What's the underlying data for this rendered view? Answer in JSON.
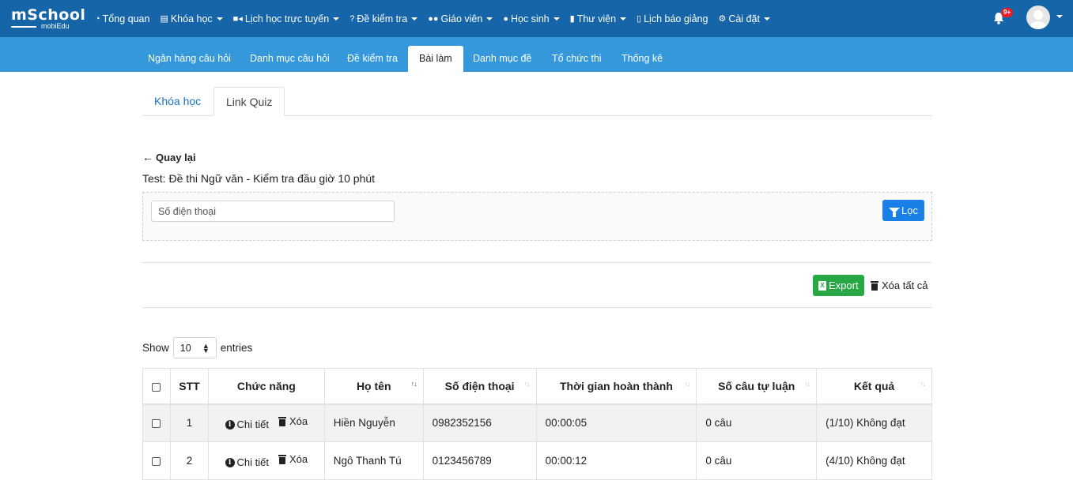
{
  "logo": {
    "main": "mSchool",
    "sub": "mobiEdu"
  },
  "nav": [
    {
      "label": "Tổng quan",
      "icon": "dashboard-icon",
      "caret": false
    },
    {
      "label": "Khóa học",
      "icon": "list-icon",
      "caret": true
    },
    {
      "label": "Lịch học trực tuyến",
      "icon": "video-icon",
      "caret": true
    },
    {
      "label": "Đề kiểm tra",
      "icon": "question-icon",
      "caret": true
    },
    {
      "label": "Giáo viên",
      "icon": "users-icon",
      "caret": true
    },
    {
      "label": "Học sinh",
      "icon": "user-icon",
      "caret": true
    },
    {
      "label": "Thư viện",
      "icon": "book-icon",
      "caret": true
    },
    {
      "label": "Lịch báo giảng",
      "icon": "clipboard-icon",
      "caret": false
    },
    {
      "label": "Cài đặt",
      "icon": "gears-icon",
      "caret": true
    }
  ],
  "notifications": {
    "badge": "9+"
  },
  "subnav": [
    "Ngân hàng câu hỏi",
    "Danh mục câu hỏi",
    "Đề kiểm tra",
    "Bài làm",
    "Danh mục đề",
    "Tổ chức thi",
    "Thống kê"
  ],
  "subnav_active": "Bài làm",
  "inner_tabs": [
    "Khóa học",
    "Link Quiz"
  ],
  "inner_tabs_active": "Link Quiz",
  "back_label": "Quay lại",
  "test_title": "Test: Đề thi Ngữ văn - Kiểm tra đầu giờ 10 phút",
  "filter": {
    "phone_placeholder": "Số điện thoại",
    "button_label": "Lọc"
  },
  "actions": {
    "export_label": "Export",
    "delete_all_label": "Xóa tất cả"
  },
  "entries": {
    "show_label": "Show",
    "value": "10",
    "entries_label": "entries"
  },
  "table": {
    "headers": [
      "STT",
      "Chức năng",
      "Họ tên",
      "Số điện thoại",
      "Thời gian hoàn thành",
      "Số câu tự luận",
      "Kết quả"
    ],
    "detail_label": "Chi tiết",
    "delete_label": "Xóa",
    "rows": [
      {
        "stt": "1",
        "name": "Hiền Nguyễn",
        "phone": "0982352156",
        "time": "00:00:05",
        "essay": "0 câu",
        "result": "(1/10) Không đạt"
      },
      {
        "stt": "2",
        "name": "Ngô Thanh Tú",
        "phone": "0123456789",
        "time": "00:00:12",
        "essay": "0 câu",
        "result": "(4/10) Không đạt"
      }
    ]
  }
}
